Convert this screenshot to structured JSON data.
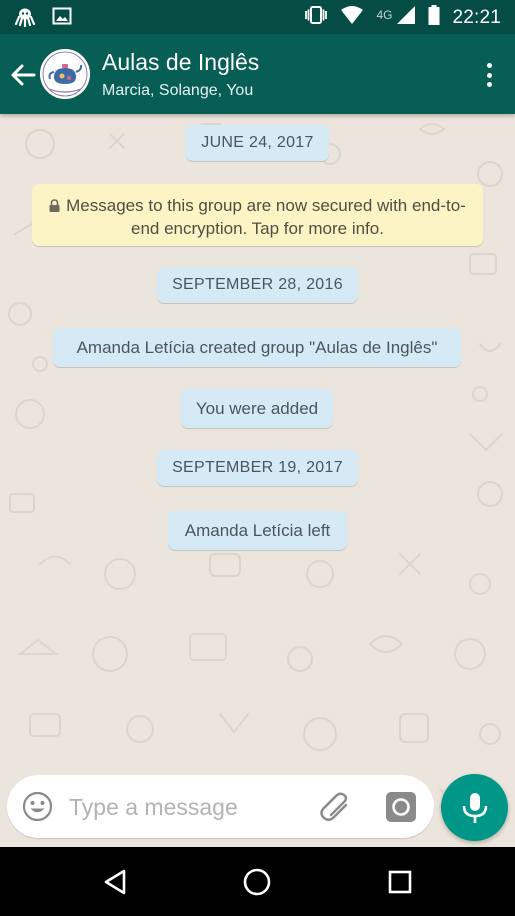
{
  "status_bar": {
    "time": "22:21",
    "network_label": "4G",
    "icons": [
      "notification-octopus-icon",
      "image-notification-icon",
      "vibrate-icon",
      "wifi-icon",
      "signal-icon",
      "battery-icon"
    ]
  },
  "header": {
    "title": "Aulas de Inglês",
    "subtitle": "Marcia, Solange, You",
    "avatar_icon": "teapot-logo-avatar",
    "colors": {
      "app_bar": "#075e54",
      "status_bar": "#054d44"
    }
  },
  "chat": {
    "wallpaper_color": "#ece5dd",
    "items": [
      {
        "kind": "date",
        "text": "JUNE 24, 2017"
      },
      {
        "kind": "encryption",
        "text": "Messages to this group are now secured with end-to-end encryption. Tap for more info."
      },
      {
        "kind": "date",
        "text": "SEPTEMBER 28, 2016"
      },
      {
        "kind": "event",
        "text": "Amanda Letícia created group \"Aulas de Inglês\""
      },
      {
        "kind": "event",
        "text": "You were added"
      },
      {
        "kind": "date",
        "text": "SEPTEMBER 19, 2017"
      },
      {
        "kind": "event",
        "text": "Amanda Letícia left"
      }
    ]
  },
  "composer": {
    "placeholder": "Type a message",
    "value": "",
    "icons": [
      "emoji-icon",
      "paperclip-icon",
      "camera-icon",
      "microphone-icon"
    ],
    "accent": "#009688"
  },
  "nav_bar": {
    "icons": [
      "back-triangle-icon",
      "home-circle-icon",
      "recents-square-icon"
    ]
  }
}
